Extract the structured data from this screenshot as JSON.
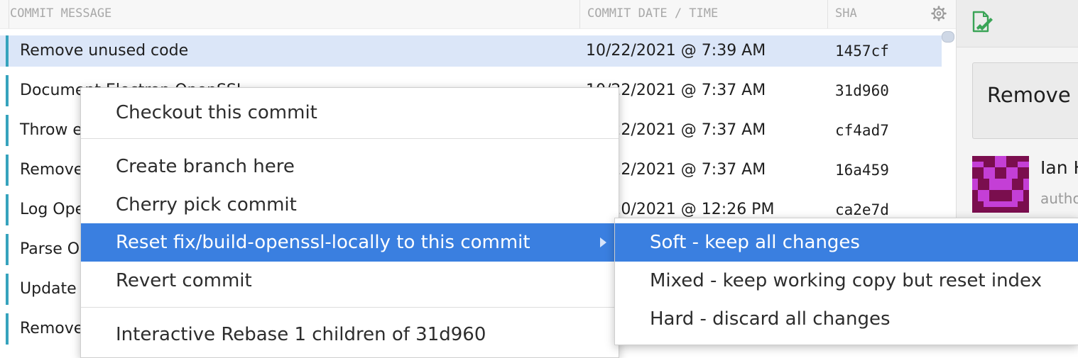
{
  "table": {
    "headers": {
      "message": "COMMIT MESSAGE",
      "date": "COMMIT DATE / TIME",
      "sha": "SHA"
    },
    "rows": [
      {
        "message": "Remove unused code",
        "date": "10/22/2021 @ 7:39 AM",
        "sha": "1457cf",
        "selected": true
      },
      {
        "message": "Document Electron OpenSSL",
        "date": "10/22/2021 @ 7:37 AM",
        "sha": "31d960"
      },
      {
        "message": "Throw e",
        "date": "10/22/2021 @ 7:37 AM",
        "sha": "cf4ad7"
      },
      {
        "message": "Remove",
        "date": "10/22/2021 @ 7:37 AM",
        "sha": "16a459"
      },
      {
        "message": "Log Ope",
        "date": "10/20/2021 @ 12:26 PM",
        "sha": "ca2e7d"
      },
      {
        "message": "Parse O",
        "date": "",
        "sha": ""
      },
      {
        "message": "Update",
        "date": "",
        "sha": ""
      },
      {
        "message": "Remove",
        "date": "",
        "sha": ""
      }
    ]
  },
  "right_panel": {
    "message_preview": "Remove",
    "author_name": "Ian H",
    "author_role": "autho"
  },
  "context_menu": {
    "items": [
      {
        "label": "Checkout this commit"
      },
      {
        "label": "Create branch here"
      },
      {
        "label": "Cherry pick commit"
      },
      {
        "label": "Reset fix/build-openssl-locally to this commit",
        "active": true,
        "has_submenu": true
      },
      {
        "label": "Revert commit"
      },
      {
        "label": "Interactive Rebase 1 children of 31d960"
      }
    ],
    "submenu": [
      {
        "label": "Soft - keep all changes",
        "active": true
      },
      {
        "label": "Mixed - keep working copy but reset index"
      },
      {
        "label": "Hard - discard all changes"
      }
    ]
  },
  "colors": {
    "selection": "#3a7fe0",
    "row_selected": "#dbe6f8",
    "branch_bar": "#36a3bd",
    "avatar_fg": "#c43fd6",
    "avatar_bg": "#7a0e4e"
  },
  "icons": {
    "settings": "gear-icon",
    "edit_message": "edit-document-icon",
    "avatar": "identicon-avatar",
    "submenu": "chevron-right-icon"
  }
}
